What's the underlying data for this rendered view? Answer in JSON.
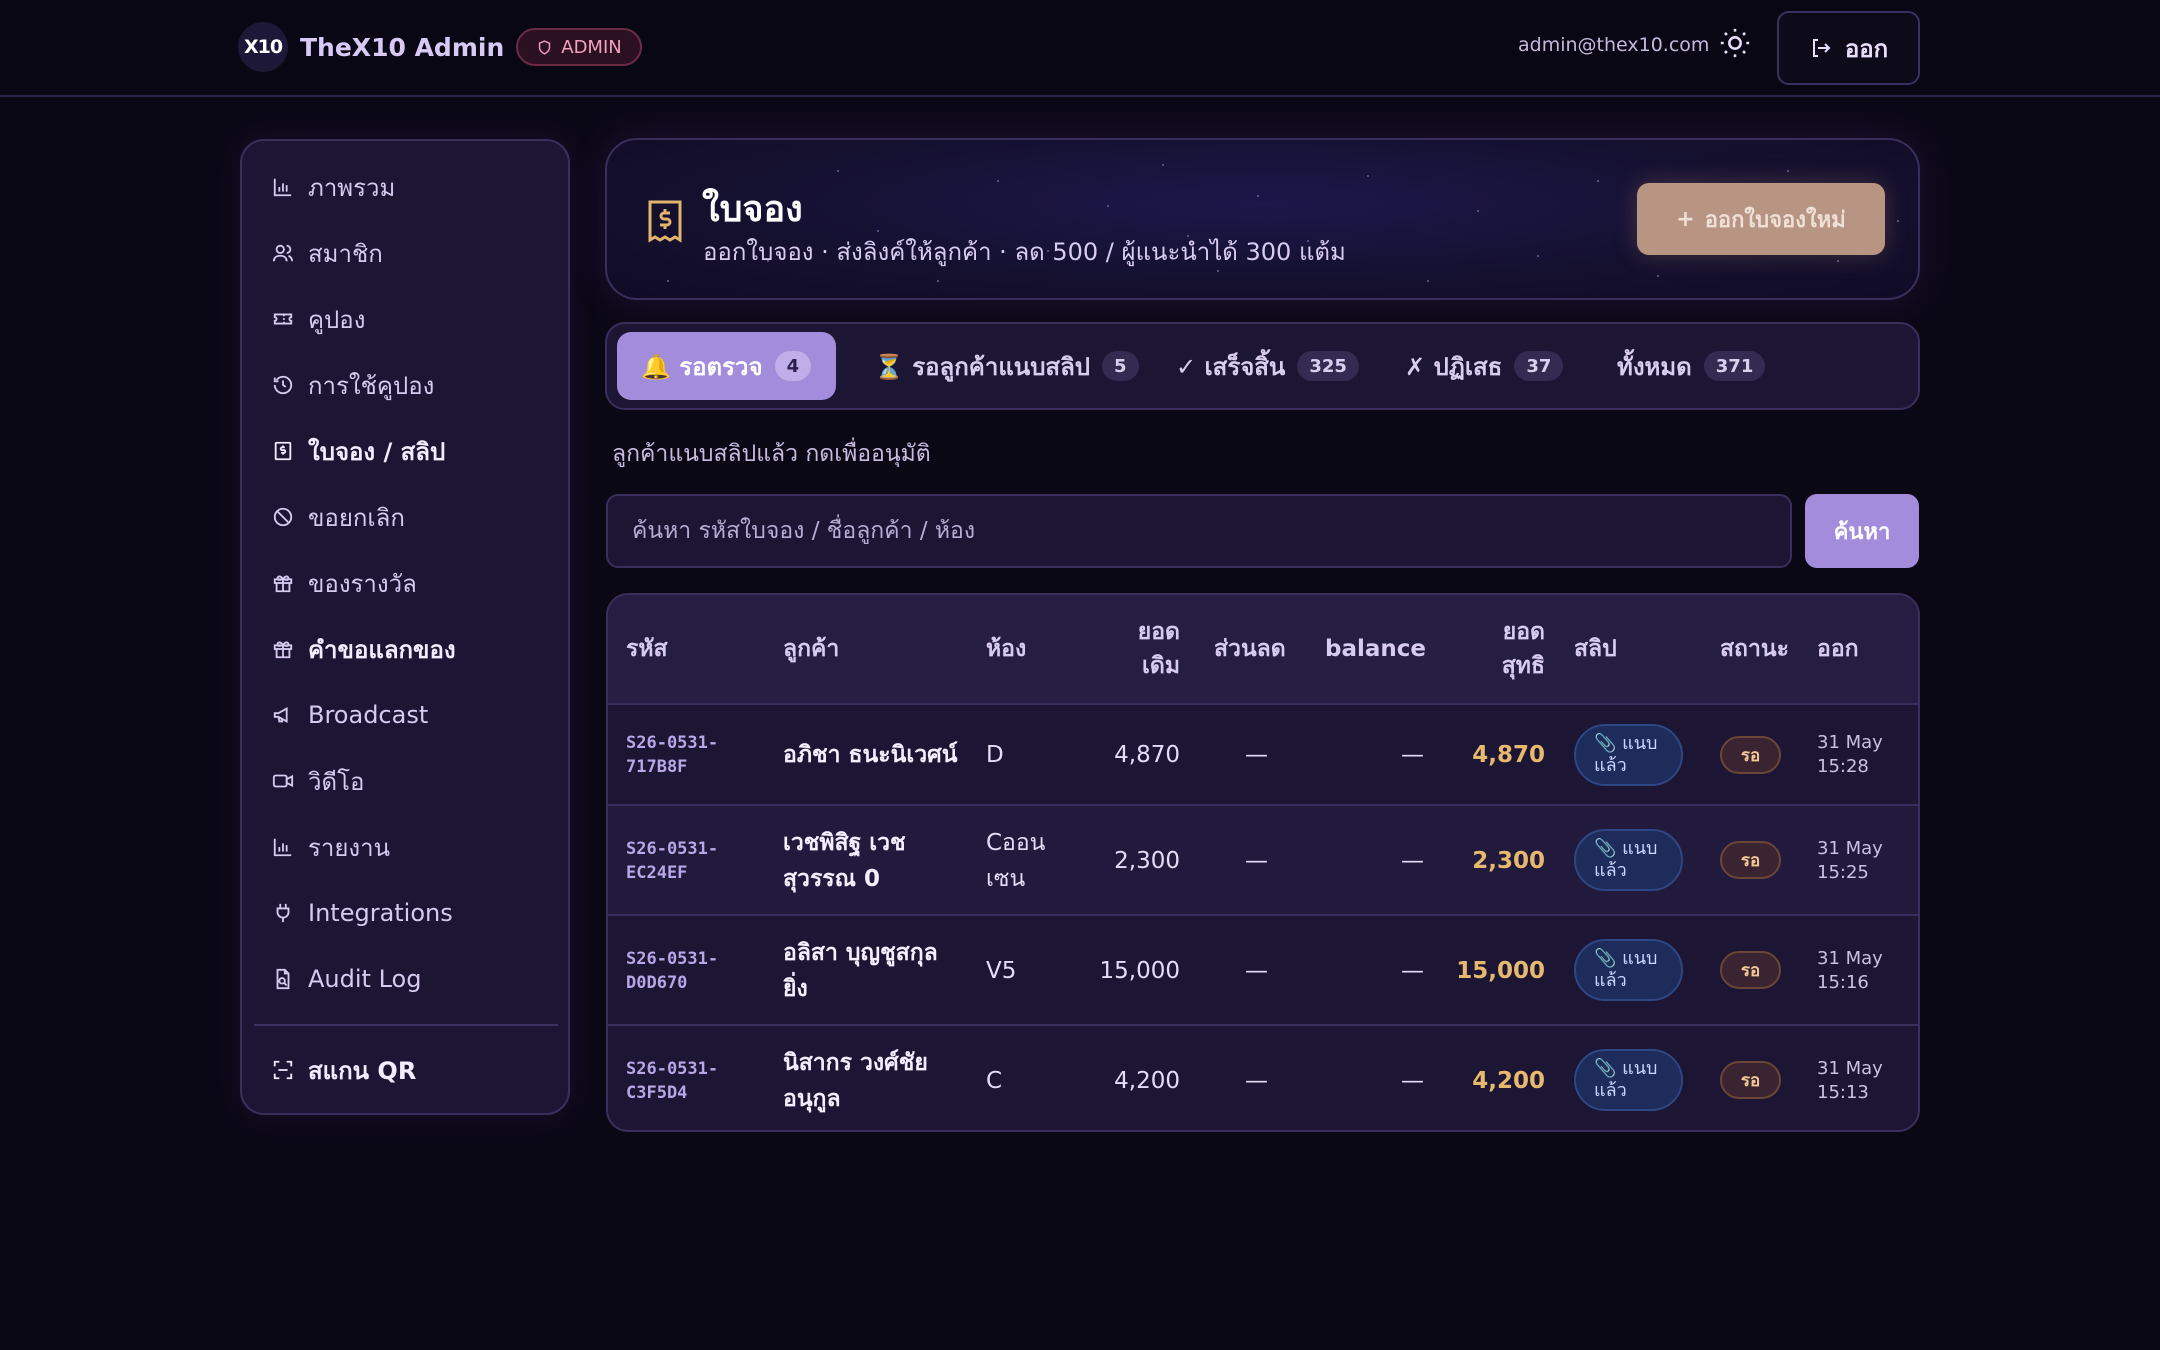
{
  "header": {
    "logo": "X10",
    "app_title": "TheX10 Admin",
    "role_badge": "ADMIN",
    "user_email": "admin@thex10.com",
    "logout_label": "ออก"
  },
  "sidebar": {
    "items": [
      {
        "label": "ภาพรวม",
        "icon": "bar-chart-icon"
      },
      {
        "label": "สมาชิก",
        "icon": "users-icon"
      },
      {
        "label": "คูปอง",
        "icon": "ticket-icon"
      },
      {
        "label": "การใช้คูปอง",
        "icon": "history-icon"
      },
      {
        "label": "ใบจอง / สลิป",
        "icon": "receipt-icon",
        "active": true
      },
      {
        "label": "ขอยกเลิก",
        "icon": "ban-icon"
      },
      {
        "label": "ของรางวัล",
        "icon": "gift-icon"
      },
      {
        "label": "คำขอแลกของ",
        "icon": "gift-icon"
      },
      {
        "label": "Broadcast",
        "icon": "megaphone-icon"
      },
      {
        "label": "วิดีโอ",
        "icon": "video-icon"
      },
      {
        "label": "รายงาน",
        "icon": "bar-chart-icon"
      },
      {
        "label": "Integrations",
        "icon": "plug-icon"
      },
      {
        "label": "Audit Log",
        "icon": "file-search-icon"
      }
    ],
    "scan_label": "สแกน QR"
  },
  "hero": {
    "title": "ใบจอง",
    "subtitle": "ออกใบจอง · ส่งลิงค์ให้ลูกค้า · ลด 500 / ผู้แนะนำได้ 300 แต้ม",
    "new_button": "ออกใบจองใหม่"
  },
  "tabs": [
    {
      "label": "🔔 รอตรวจ",
      "count": "4",
      "active": true
    },
    {
      "label": "⏳ รอลูกค้าแนบสลิป",
      "count": "5"
    },
    {
      "label": "✓ เสร็จสิ้น",
      "count": "325"
    },
    {
      "label": "✗ ปฏิเสธ",
      "count": "37"
    },
    {
      "label": "ทั้งหมด",
      "count": "371"
    }
  ],
  "helper_text": "ลูกค้าแนบสลิปแล้ว กดเพื่ออนุมัติ",
  "search": {
    "placeholder": "ค้นหา รหัสใบจอง / ชื่อลูกค้า / ห้อง",
    "value": "",
    "button": "ค้นหา"
  },
  "table": {
    "headers": {
      "code": "รหัส",
      "customer": "ลูกค้า",
      "room": "ห้อง",
      "original": "ยอด เดิม",
      "discount": "ส่วนลด",
      "balance": "balance",
      "net": "ยอด สุทธิ",
      "slip": "สลิป",
      "status": "สถานะ",
      "issued": "ออก"
    },
    "rows": [
      {
        "code": "S26-0531-717B8F",
        "customer": "อภิชา ธนะนิเวศน์",
        "room": "D",
        "original": "4,870",
        "discount": "—",
        "balance": "—",
        "net": "4,870",
        "slip": "📎 แนบแล้ว",
        "status": "รอ",
        "issued": "31 May 15:28"
      },
      {
        "code": "S26-0531-EC24EF",
        "customer": "เวชพิสิฐ เวชสุวรรณ 0",
        "room": "Cออนเซน",
        "original": "2,300",
        "discount": "—",
        "balance": "—",
        "net": "2,300",
        "slip": "📎 แนบแล้ว",
        "status": "รอ",
        "issued": "31 May 15:25"
      },
      {
        "code": "S26-0531-D0D670",
        "customer": "อลิสา บุญชูสกุลยิ่ง",
        "room": "V5",
        "original": "15,000",
        "discount": "—",
        "balance": "—",
        "net": "15,000",
        "slip": "📎 แนบแล้ว",
        "status": "รอ",
        "issued": "31 May 15:16"
      },
      {
        "code": "S26-0531-C3F5D4",
        "customer": "นิสากร วงศ์ชัยอนุกูล",
        "room": "C",
        "original": "4,200",
        "discount": "—",
        "balance": "—",
        "net": "4,200",
        "slip": "📎 แนบแล้ว",
        "status": "รอ",
        "issued": "31 May 15:13"
      }
    ]
  },
  "colors": {
    "background": "#0b0816",
    "accent": "#a38cdc",
    "net_amount": "#e6b96f",
    "new_button": "#b89482"
  }
}
